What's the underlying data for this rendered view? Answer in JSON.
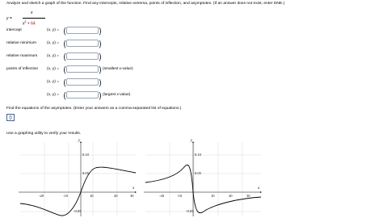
{
  "question": {
    "prompt": "Analyze and sketch a graph of the function. Find any intercepts, relative extrema, points of inflection, and asymptotes. (If an answer does not exist, enter DNE.)",
    "equation": {
      "lhs": "y =",
      "numerator": "x",
      "denominator_var": "x",
      "denominator_exp": "2",
      "denominator_const": "+ 64"
    }
  },
  "rows": [
    {
      "label": "intercept",
      "coord": "(x, y)  =",
      "value": "",
      "note": ""
    },
    {
      "label": "relative minimum",
      "coord": "(x, y)  =",
      "value": "",
      "note": ""
    },
    {
      "label": "relative maximum",
      "coord": "(x, y)  =",
      "value": "",
      "note": ""
    },
    {
      "label": "points of inflection",
      "coord": "(x, y)  =",
      "value": "",
      "note": "(smallest x-value)"
    },
    {
      "label": "",
      "coord": "(x, y)  =",
      "value": "",
      "note": ""
    },
    {
      "label": "",
      "coord": "(x, y)  =",
      "value": "",
      "note": "(largest x-value)"
    }
  ],
  "asymptotes": {
    "prompt": "Find the equations of the asymptotes. (Enter your answers as a comma-separated list of equations.)",
    "value": "()"
  },
  "graphing": {
    "prompt": "Use a graphing utility to verify your results."
  },
  "graphs": [
    {
      "y_label": "y",
      "x_label": "x",
      "y_ticks": [
        "0.10",
        "0.05",
        "-0.05"
      ],
      "x_ticks": [
        "-20",
        "-10",
        "10",
        "20",
        "30"
      ]
    },
    {
      "y_label": "y",
      "x_label": "x",
      "y_ticks": [
        "0.10",
        "0.05",
        "-0.05"
      ],
      "x_ticks": [
        "-20",
        "-10",
        "10",
        "20",
        "30"
      ]
    }
  ],
  "colors": {
    "box_border": "#9aa6b2",
    "asymptote_box_border": "#3b63a8",
    "highlight": "#c00000"
  }
}
